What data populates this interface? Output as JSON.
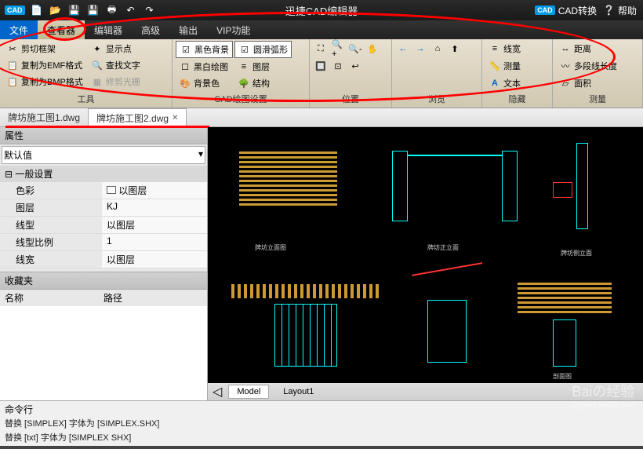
{
  "title": "迅捷CAD编辑器",
  "qat": {
    "logo": "CAD"
  },
  "titleRight": {
    "convert": "CAD转换",
    "help": "帮助"
  },
  "menu": {
    "items": [
      "文件",
      "查看器",
      "编辑器",
      "高级",
      "输出",
      "VIP功能"
    ]
  },
  "ribbon": {
    "groups": [
      {
        "label": "工具",
        "items": [
          "剪切框架",
          "复制为EMF格式",
          "复制为BMP格式",
          "显示点",
          "查找文字",
          "修剪光栅"
        ]
      },
      {
        "label": "CAD绘图设置",
        "items": [
          "黑色背景",
          "黑白绘图",
          "背景色",
          "圆滑弧形",
          "图层",
          "结构"
        ]
      },
      {
        "label": "位置",
        "items": []
      },
      {
        "label": "浏览",
        "items": []
      },
      {
        "label": "隐藏",
        "items": [
          "线宽",
          "测量",
          "文本"
        ]
      },
      {
        "label": "测量",
        "items": [
          "距离",
          "多段线长度",
          "面积"
        ]
      }
    ]
  },
  "tabs": {
    "items": [
      "牌坊施工图1.dwg",
      "牌坊施工图2.dwg"
    ]
  },
  "properties": {
    "title": "属性",
    "dropdown": "默认值",
    "section": "一般设置",
    "rows": [
      {
        "key": "色彩",
        "val": "以图层"
      },
      {
        "key": "图层",
        "val": "KJ"
      },
      {
        "key": "线型",
        "val": "以图层"
      },
      {
        "key": "线型比例",
        "val": "1"
      },
      {
        "key": "线宽",
        "val": "以图层"
      }
    ],
    "favorites": {
      "title": "收藏夹",
      "cols": [
        "名称",
        "路径"
      ]
    }
  },
  "canvas": {
    "tabs": [
      "Model",
      "Layout1"
    ],
    "labels": [
      "牌坊立面图",
      "牌坊正立面",
      "牌坊侧立面",
      "剖面图"
    ]
  },
  "cmdline": {
    "title": "命令行",
    "lines": [
      "替换 [SIMPLEX] 字体为 [SIMPLEX.SHX]",
      "替换 [txt] 字体为 [SIMPLEX SHX]"
    ]
  },
  "watermark": {
    "text": "Baiの经验",
    "sub": "jingyan.baidu.com"
  }
}
